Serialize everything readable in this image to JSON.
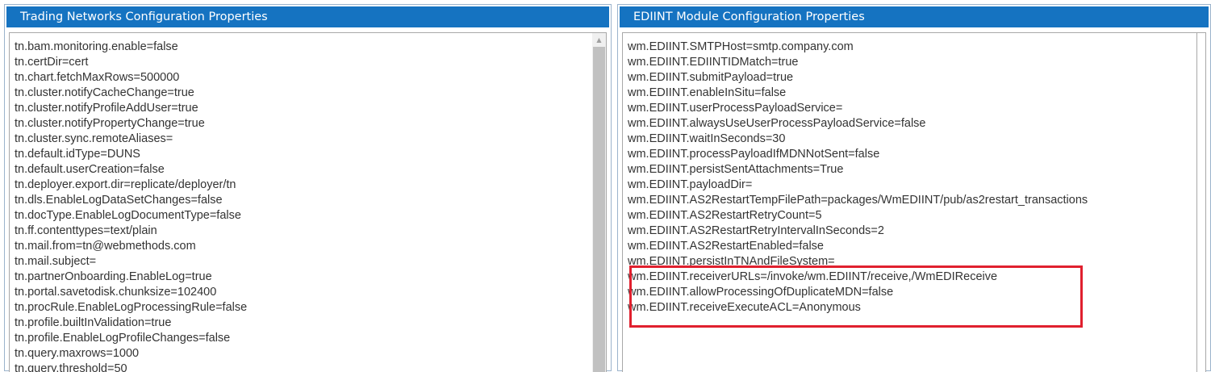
{
  "left_panel": {
    "title": "Trading Networks Configuration Properties",
    "lines": [
      "tn.bam.monitoring.enable=false",
      "tn.certDir=cert",
      "tn.chart.fetchMaxRows=500000",
      "tn.cluster.notifyCacheChange=true",
      "tn.cluster.notifyProfileAddUser=true",
      "tn.cluster.notifyPropertyChange=true",
      "tn.cluster.sync.remoteAliases=",
      "tn.default.idType=DUNS",
      "tn.default.userCreation=false",
      "tn.deployer.export.dir=replicate/deployer/tn",
      "tn.dls.EnableLogDataSetChanges=false",
      "tn.docType.EnableLogDocumentType=false",
      "tn.ff.contenttypes=text/plain",
      "tn.mail.from=tn@webmethods.com",
      "tn.mail.subject=",
      "tn.partnerOnboarding.EnableLog=true",
      "tn.portal.savetodisk.chunksize=102400",
      "tn.procRule.EnableLogProcessingRule=false",
      "tn.profile.builtInValidation=true",
      "tn.profile.EnableLogProfileChanges=false",
      "tn.query.maxrows=1000",
      "tn.query.threshold=50"
    ]
  },
  "right_panel": {
    "title": "EDIINT Module Configuration Properties",
    "lines": [
      "wm.EDIINT.SMTPHost=smtp.company.com",
      "wm.EDIINT.EDIINTIDMatch=true",
      "wm.EDIINT.submitPayload=true",
      "wm.EDIINT.enableInSitu=false",
      "wm.EDIINT.userProcessPayloadService=",
      "wm.EDIINT.alwaysUseUserProcessPayloadService=false",
      "wm.EDIINT.waitInSeconds=30",
      "wm.EDIINT.processPayloadIfMDNNotSent=false",
      "wm.EDIINT.persistSentAttachments=True",
      "wm.EDIINT.payloadDir=",
      "wm.EDIINT.AS2RestartTempFilePath=packages/WmEDIINT/pub/as2restart_transactions",
      "wm.EDIINT.AS2RestartRetryCount=5",
      "wm.EDIINT.AS2RestartRetryIntervalInSeconds=2",
      "wm.EDIINT.AS2RestartEnabled=false",
      "wm.EDIINT.persistInTNAndFileSystem=",
      "wm.EDIINT.receiverURLs=/invoke/wm.EDIINT/receive,/WmEDIReceive",
      "wm.EDIINT.allowProcessingOfDuplicateMDN=false",
      "wm.EDIINT.receiveExecuteACL=Anonymous"
    ]
  },
  "colors": {
    "header_bg": "#1573c1",
    "header_text": "#ffffff",
    "highlight": "#e0202e"
  },
  "icons": {
    "scroll_up": "scroll-up-arrow-icon"
  }
}
